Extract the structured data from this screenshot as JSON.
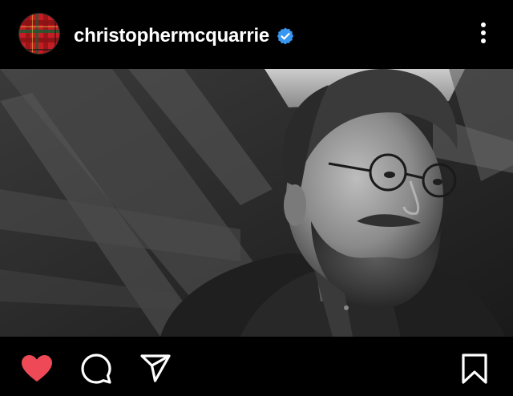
{
  "header": {
    "username": "christophermcquarrie",
    "verified": true,
    "avatar_icon": "tartan-plaid-avatar",
    "more_icon": "vertical-ellipsis-icon"
  },
  "photo": {
    "style": "black-and-white portrait",
    "subject": "bearded man with round glasses in an attic"
  },
  "actions": {
    "like_icon": "heart-filled-icon",
    "comment_icon": "comment-bubble-icon",
    "share_icon": "paper-plane-icon",
    "save_icon": "bookmark-icon",
    "liked": true
  },
  "colors": {
    "background": "#000000",
    "text": "#ffffff",
    "verified_badge": "#3897f0",
    "like_red": "#ed4956",
    "avatar_red": "#c41e24",
    "avatar_green": "#1f5a32"
  }
}
